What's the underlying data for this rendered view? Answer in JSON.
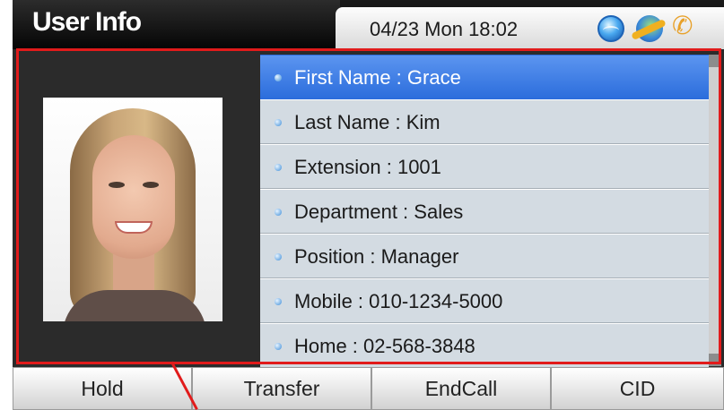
{
  "header": {
    "title": "User Info",
    "datetime": "04/23 Mon 18:02",
    "icons": [
      "globe-icon",
      "network-icon",
      "phone-icon"
    ]
  },
  "user": {
    "photo_alt": "User photo",
    "fields": [
      "First Name : Grace",
      "Last Name : Kim",
      "Extension : 1001",
      "Department : Sales",
      "Position : Manager",
      "Mobile : 010-1234-5000",
      "Home : 02-568-3848"
    ],
    "selected_index": 0
  },
  "softkeys": [
    "Hold",
    "Transfer",
    "EndCall",
    "CID"
  ],
  "colors": {
    "selected": "#2c6ddc",
    "list_bg": "#d3dbe2",
    "highlight": "#e11b1b"
  }
}
